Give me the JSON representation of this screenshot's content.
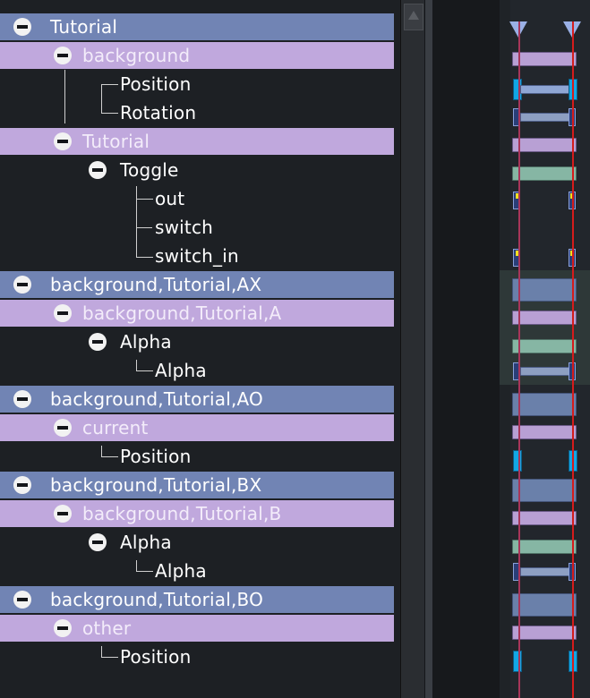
{
  "tree": {
    "rows": [
      {
        "label": "Tutorial",
        "style": "blue",
        "level": 0
      },
      {
        "label": "background",
        "style": "purple",
        "level": 1
      },
      {
        "label": "Position",
        "style": "item",
        "level": 2
      },
      {
        "label": "Rotation",
        "style": "item",
        "level": 2
      },
      {
        "label": "Tutorial",
        "style": "purple",
        "level": 1
      },
      {
        "label": "Toggle",
        "style": "group",
        "level": 2
      },
      {
        "label": "out",
        "style": "item",
        "level": 3
      },
      {
        "label": "switch",
        "style": "item",
        "level": 3
      },
      {
        "label": "switch_in",
        "style": "item",
        "level": 3
      },
      {
        "label": "background,Tutorial,AX",
        "style": "blue",
        "level": 0
      },
      {
        "label": "background,Tutorial,A",
        "style": "purple",
        "level": 1
      },
      {
        "label": "Alpha",
        "style": "group",
        "level": 2
      },
      {
        "label": "Alpha",
        "style": "item",
        "level": 3
      },
      {
        "label": "background,Tutorial,AO",
        "style": "blue",
        "level": 0
      },
      {
        "label": "current",
        "style": "purple",
        "level": 1
      },
      {
        "label": "Position",
        "style": "item",
        "level": 2
      },
      {
        "label": "background,Tutorial,BX",
        "style": "blue",
        "level": 0
      },
      {
        "label": "background,Tutorial,B",
        "style": "purple",
        "level": 1
      },
      {
        "label": "Alpha",
        "style": "group",
        "level": 2
      },
      {
        "label": "Alpha",
        "style": "item",
        "level": 3
      },
      {
        "label": "background,Tutorial,BO",
        "style": "blue",
        "level": 0
      },
      {
        "label": "other",
        "style": "purple",
        "level": 1
      },
      {
        "label": "Position",
        "style": "item",
        "level": 2
      }
    ]
  },
  "colors": {
    "group_blue": "#7184b4",
    "group_purple": "#c0a8dd",
    "playhead": "#d51c1c",
    "key_cyan": "#12a7e6"
  }
}
